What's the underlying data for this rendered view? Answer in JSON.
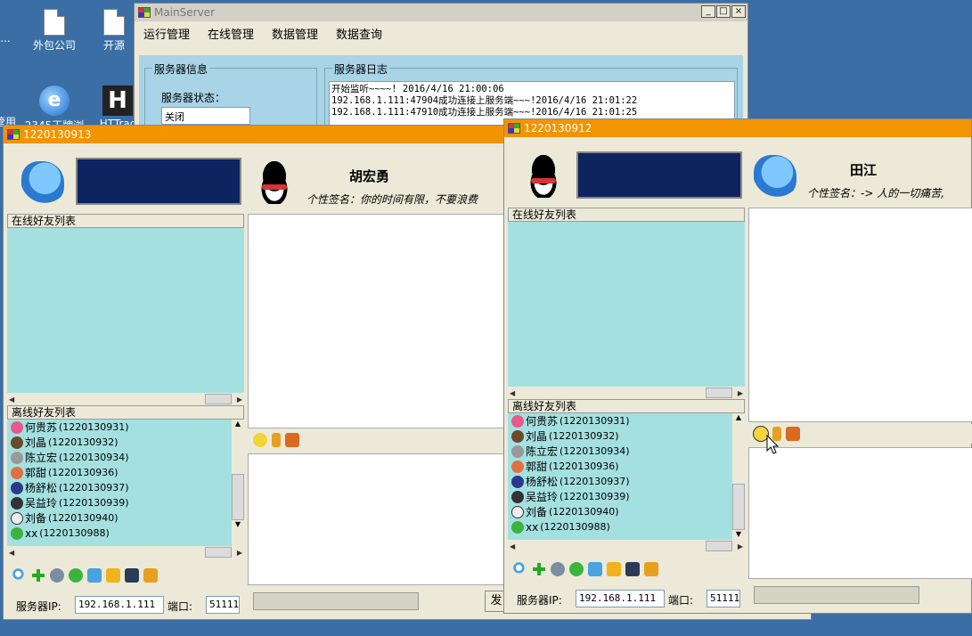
{
  "desktop": {
    "icons": [
      {
        "label": "外包公司"
      },
      {
        "label": "开源"
      },
      {
        "label": "2345王牌浏"
      },
      {
        "label": "HTTrac"
      },
      {
        "label": "..."
      },
      {
        "label": "管用"
      }
    ]
  },
  "main_server": {
    "title": "MainServer",
    "menu": [
      "运行管理",
      "在线管理",
      "数据管理",
      "数据查询"
    ],
    "server_info": {
      "legend": "服务器信息",
      "status_label": "服务器状态：",
      "status_value": "关闭"
    },
    "server_log": {
      "legend": "服务器日志",
      "lines": [
        "开始监听~~~~! 2016/4/16 21:00:06",
        "192.168.1.111:47904成功连接上服务端~~~!2016/4/16 21:01:22",
        "192.168.1.111:47910成功连接上服务端~~~!2016/4/16 21:01:25"
      ]
    },
    "window_buttons": [
      "_",
      "□",
      "×"
    ]
  },
  "chat1": {
    "title": "1220130913",
    "peer_name": "胡宏勇",
    "signature": "个性签名：你的时间有限，不要浪费",
    "online_header": "在线好友列表",
    "offline_header": "离线好友列表",
    "offline_friends": [
      {
        "name": "何贵苏",
        "id": "(1220130931)"
      },
      {
        "name": "刘晶",
        "id": "(1220130932)"
      },
      {
        "name": "陈立宏",
        "id": "(1220130934)"
      },
      {
        "name": "郭甜",
        "id": "(1220130936)"
      },
      {
        "name": "杨舒松",
        "id": "(1220130937)"
      },
      {
        "name": "吴益玲",
        "id": "(1220130939)"
      },
      {
        "name": "刘备",
        "id": "(1220130940)"
      },
      {
        "name": "xx",
        "id": "(1220130988)"
      }
    ],
    "server_ip_label": "服务器IP:",
    "server_ip_value": "192.168.1.111",
    "port_label": "端口:",
    "port_value": "51111",
    "send_label": "发"
  },
  "chat2": {
    "title": "1220130912",
    "peer_name": "田江",
    "signature": "个性签名：-> 人的一切痛苦,",
    "online_header": "在线好友列表",
    "offline_header": "离线好友列表",
    "offline_friends": [
      {
        "name": "何贵苏",
        "id": "(1220130931)"
      },
      {
        "name": "刘晶",
        "id": "(1220130932)"
      },
      {
        "name": "陈立宏",
        "id": "(1220130934)"
      },
      {
        "name": "郭甜",
        "id": "(1220130936)"
      },
      {
        "name": "杨舒松",
        "id": "(1220130937)"
      },
      {
        "name": "吴益玲",
        "id": "(1220130939)"
      },
      {
        "name": "刘备",
        "id": "(1220130940)"
      },
      {
        "name": "xx",
        "id": "(1220130988)"
      }
    ],
    "server_ip_label": "服务器IP:",
    "server_ip_value": "192.168.1.111",
    "port_label": "端口:",
    "port_value": "51111"
  },
  "colors": {
    "desktop": "#3a6ea5",
    "title_orange": "#f29300",
    "list_cyan": "#a5e0e1",
    "navy": "#0d2460"
  }
}
